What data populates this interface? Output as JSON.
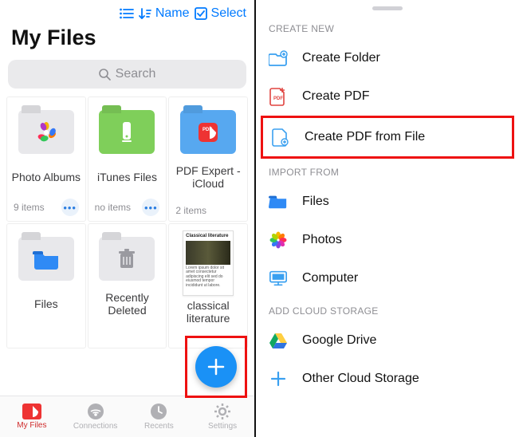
{
  "topbar": {
    "sort_label": "Name",
    "select_label": "Select"
  },
  "title": "My Files",
  "search_placeholder": "Search",
  "tiles": [
    {
      "label": "Photo Albums",
      "count": "9 items",
      "has_more": true
    },
    {
      "label": "iTunes Files",
      "count": "no items",
      "has_more": true
    },
    {
      "label": "PDF Expert - iCloud",
      "count": "2 items",
      "has_more": false
    },
    {
      "label": "Files",
      "count": "",
      "has_more": false
    },
    {
      "label": "Recently Deleted",
      "count": "",
      "has_more": false
    },
    {
      "label": "classical literature",
      "count": "",
      "has_more": false
    }
  ],
  "doc_preview": {
    "heading": "Classical literature"
  },
  "tabs": {
    "my_files": "My Files",
    "connections": "Connections",
    "recents": "Recents",
    "settings": "Settings"
  },
  "right": {
    "create_header": "CREATE NEW",
    "create_folder": "Create Folder",
    "create_pdf": "Create PDF",
    "create_pdf_file": "Create PDF from File",
    "import_header": "IMPORT FROM",
    "files": "Files",
    "photos": "Photos",
    "computer": "Computer",
    "cloud_header": "ADD CLOUD STORAGE",
    "gdrive": "Google Drive",
    "other_cloud": "Other Cloud Storage"
  }
}
